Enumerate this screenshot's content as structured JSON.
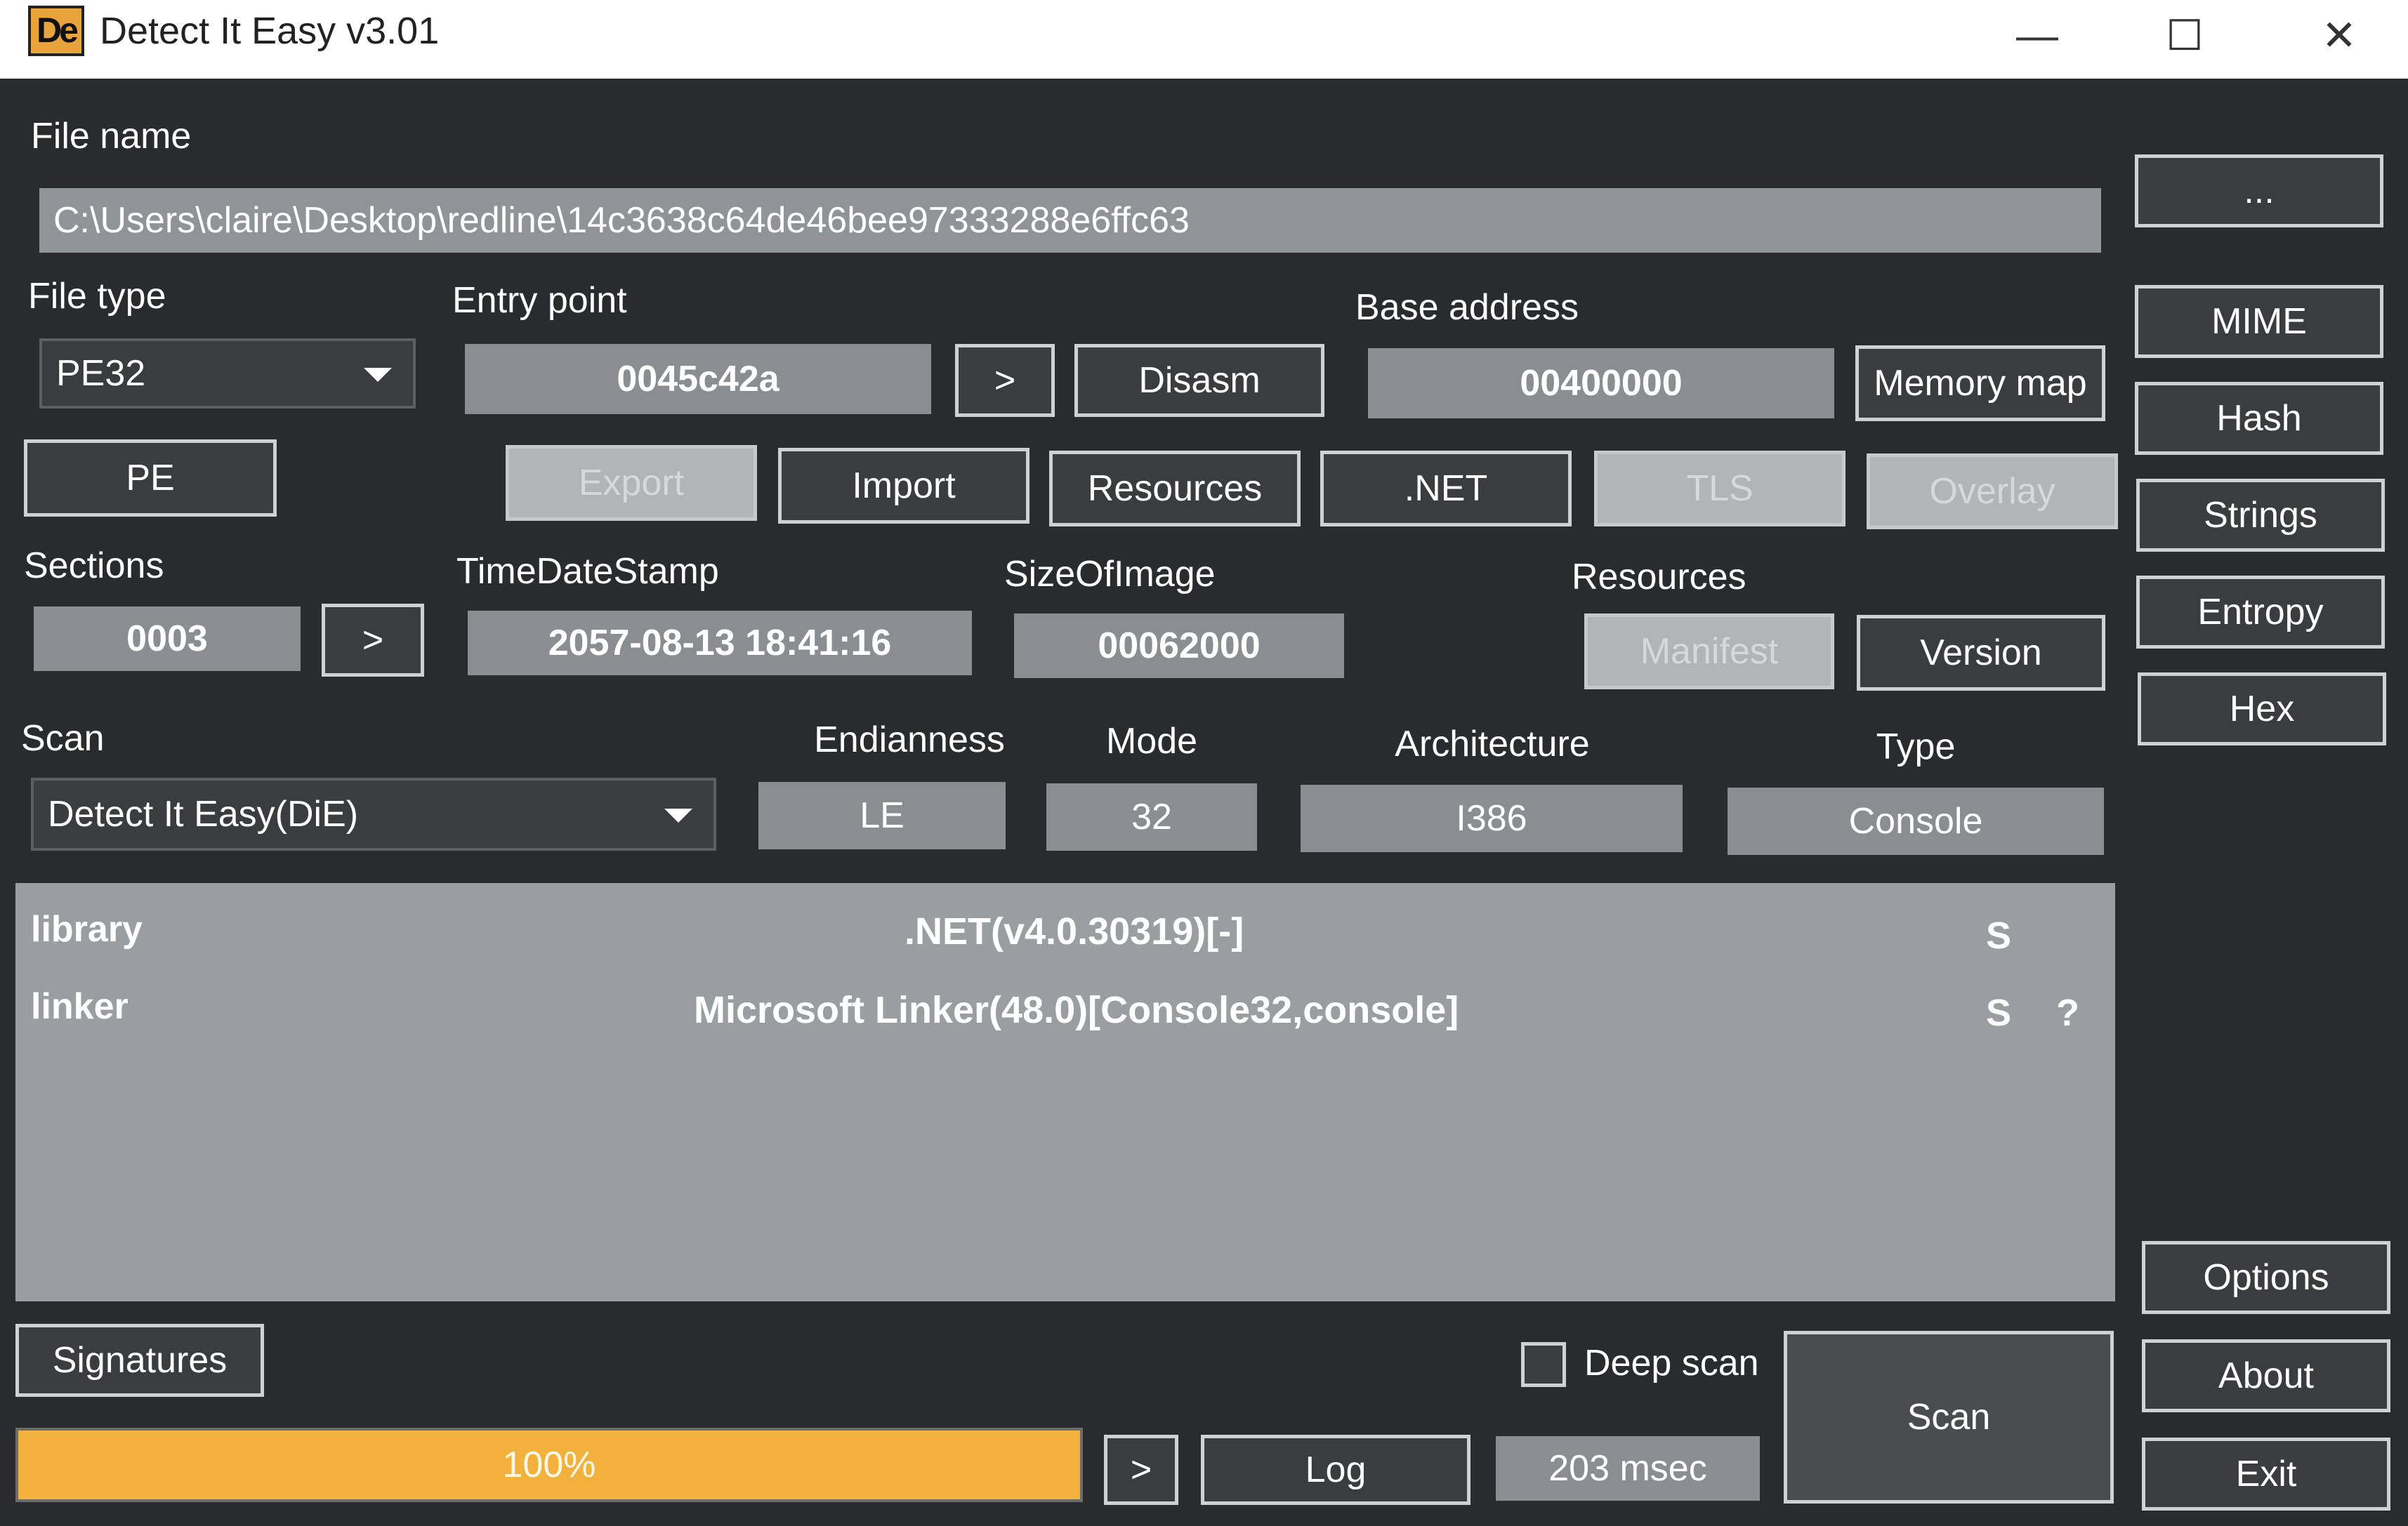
{
  "window": {
    "title": "Detect It Easy v3.01",
    "icon_text": "De",
    "minimize_glyph": "—",
    "maximize_glyph": "☐",
    "close_glyph": "✕"
  },
  "file": {
    "label": "File name",
    "path": "C:\\Users\\claire\\Desktop\\redline\\14c3638c64de46bee97333288e6ffc63",
    "browse_label": "..."
  },
  "file_type": {
    "label": "File type",
    "value": "PE32"
  },
  "entry_point": {
    "label": "Entry point",
    "value": "0045c42a",
    "go_label": ">",
    "disasm_label": "Disasm"
  },
  "base_address": {
    "label": "Base address",
    "value": "00400000",
    "memory_map_label": "Memory map"
  },
  "pe_buttons": {
    "pe": "PE",
    "export": "Export",
    "import": "Import",
    "resources": "Resources",
    "net": ".NET",
    "tls": "TLS",
    "overlay": "Overlay"
  },
  "sections": {
    "label": "Sections",
    "value": "0003",
    "go_label": ">"
  },
  "timedatestamp": {
    "label": "TimeDateStamp",
    "value": "2057-08-13 18:41:16"
  },
  "sizeofimage": {
    "label": "SizeOfImage",
    "value": "00062000"
  },
  "resources": {
    "label": "Resources",
    "manifest_label": "Manifest",
    "version_label": "Version"
  },
  "scan": {
    "label": "Scan",
    "engine": "Detect It Easy(DiE)"
  },
  "endianness": {
    "label": "Endianness",
    "value": "LE"
  },
  "mode": {
    "label": "Mode",
    "value": "32"
  },
  "architecture": {
    "label": "Architecture",
    "value": "I386"
  },
  "type": {
    "label": "Type",
    "value": "Console"
  },
  "results": [
    {
      "type": "library",
      "name": ".NET(v4.0.30319)[-]",
      "flag": "S",
      "extra": ""
    },
    {
      "type": "linker",
      "name": "Microsoft Linker(48.0)[Console32,console]",
      "flag": "S",
      "extra": "?"
    }
  ],
  "sidebar": {
    "mime": "MIME",
    "hash": "Hash",
    "strings": "Strings",
    "entropy": "Entropy",
    "hex": "Hex",
    "options": "Options",
    "about": "About",
    "exit": "Exit"
  },
  "bottom": {
    "signatures_label": "Signatures",
    "deep_scan_label": "Deep scan",
    "deep_scan_checked": false,
    "scan_label": "Scan",
    "progress": 100,
    "progress_text": "100%",
    "go_label": ">",
    "log_label": "Log",
    "elapsed": "203 msec"
  },
  "colors": {
    "background": "#292b2c",
    "progress_fill": "#f2b13c",
    "field": "#8a8e90",
    "results_bg": "#9a9ea0"
  }
}
